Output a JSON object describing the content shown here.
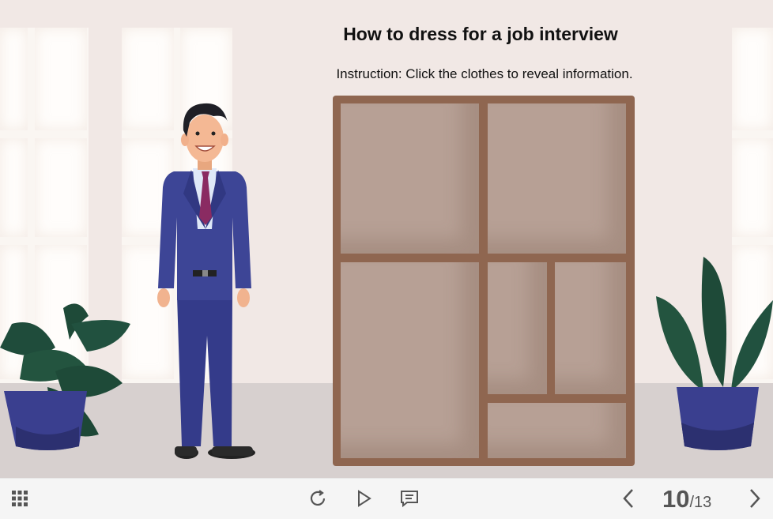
{
  "slide": {
    "title": "How to dress for a job interview",
    "instruction": "Instruction: Click the clothes to reveal information."
  },
  "pager": {
    "current": "10",
    "total": "/13"
  },
  "icons": {
    "menu": "grid-menu-icon",
    "replay": "replay-icon",
    "play": "play-icon",
    "captions": "captions-icon",
    "prev": "chevron-left-icon",
    "next": "chevron-right-icon"
  },
  "colors": {
    "background": "#f1e8e5",
    "floor": "#d7d0cf",
    "wardrobe_frame": "#8f6650",
    "wardrobe_panel": "#b7a095",
    "suit": "#3d4596",
    "tie": "#8a2b62",
    "plant_leaf": "#1e4a38",
    "pot": "#3a3f8f",
    "toolbar_bg": "#f5f5f5",
    "toolbar_icon": "#555555"
  }
}
